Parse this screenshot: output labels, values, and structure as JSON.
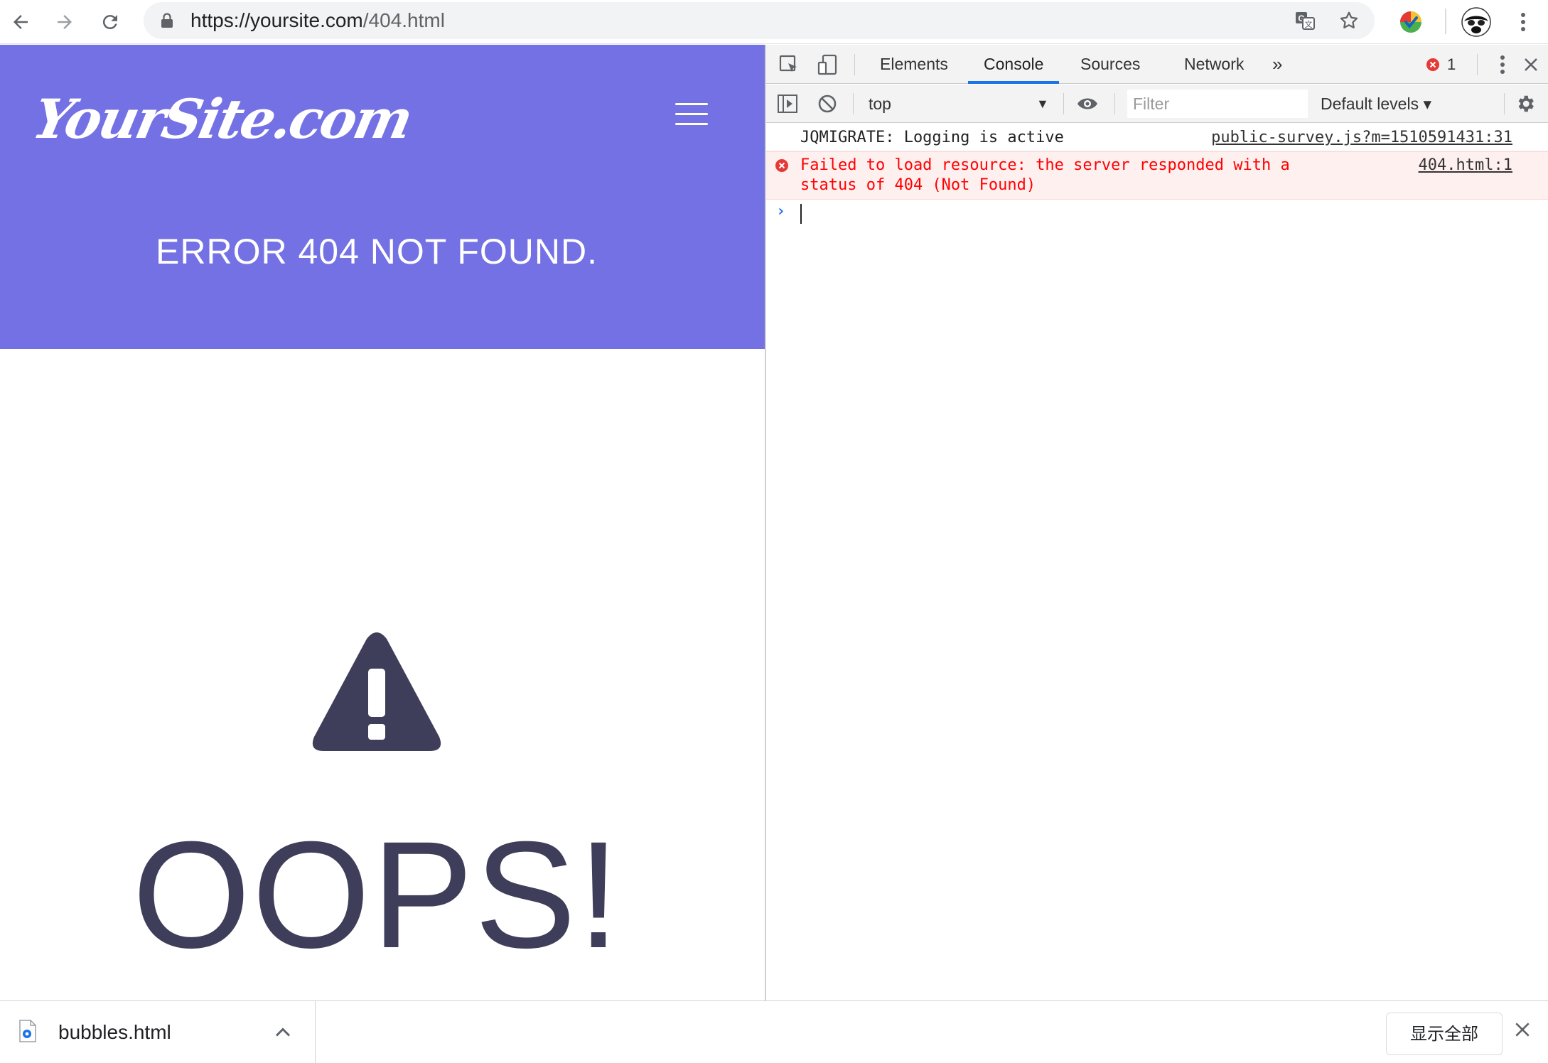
{
  "browser": {
    "url_host": "https://yoursite.com",
    "url_path": "/404.html",
    "icons": [
      "back-icon",
      "forward-icon",
      "reload-icon",
      "lock-icon",
      "translate-icon",
      "bookmark-star-icon",
      "extension-icon",
      "profile-avatar",
      "menu-kebab-icon"
    ]
  },
  "page": {
    "logo_text": "YourSite.com",
    "hero_title": "ERROR 404 NOT FOUND.",
    "oops": "OOPS!",
    "colors": {
      "hero_bg": "#7471e4",
      "text_dark": "#3e3e5a"
    }
  },
  "devtools": {
    "tabs": [
      "Elements",
      "Console",
      "Sources",
      "Network"
    ],
    "active_tab": "Console",
    "more_tabs": "»",
    "error_count": "1",
    "context": "top",
    "filter_placeholder": "Filter",
    "levels": "Default levels",
    "messages": [
      {
        "type": "log",
        "text": "JQMIGRATE: Logging is active",
        "source": "public-survey.js?m=1510591431:31"
      },
      {
        "type": "error",
        "text": "Failed to load resource: the server responded with a\nstatus of 404 (Not Found)",
        "source": "404.html:1"
      }
    ],
    "prompt": "›"
  },
  "downloads": {
    "file_name": "bubbles.html",
    "show_all": "显示全部"
  }
}
